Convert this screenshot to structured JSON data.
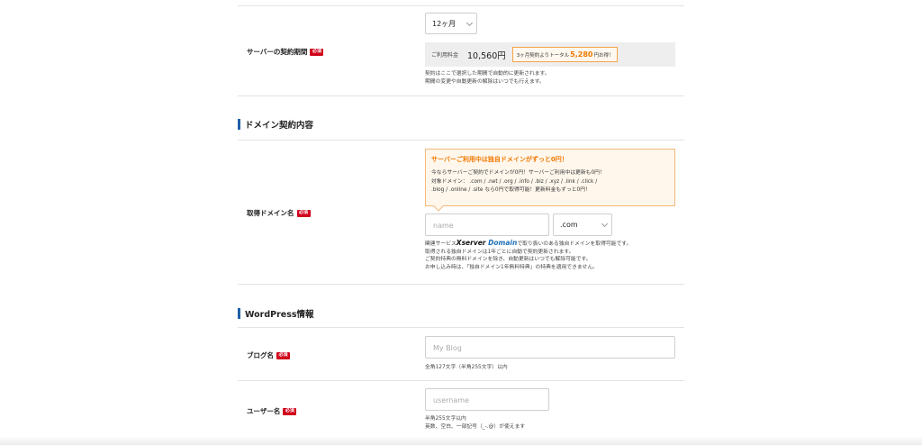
{
  "server_period": {
    "label": "サーバーの契約期間",
    "required": "必須",
    "select_value": "12ヶ月",
    "price_label": "ご利用料金",
    "price_value": "10,560円",
    "badge_prefix": "3ヶ月契約よりトータル",
    "badge_amount": "5,280",
    "badge_suffix": "円お得！",
    "notes": [
      "契約はここで選択した期間で自動的に更新されます。",
      "期間の変更や自動更新の解除はいつでも行えます。"
    ]
  },
  "domain_section": {
    "title": "ドメイン契約内容",
    "label": "取得ドメイン名",
    "required": "必須",
    "promo": {
      "title": "サーバーご利用中は独自ドメインがずっと0円！",
      "lines": [
        "今ならサーバーご契約でドメインが0円！サーバーご利用中は更新も0円！",
        "対象ドメイン： .com / .net / .org / .info / .biz / .xyz / .link / .click /",
        ".blog / .online / .site なら0円で取得可能！更新料金もずっと0円！"
      ]
    },
    "name_placeholder": "name",
    "tld_value": ".com",
    "note_prefix": "関連サービス",
    "note_logo_x": "Xserver",
    "note_logo_d": "Domain",
    "note_suffix": "で取り扱いのある独自ドメインを取得可能です。",
    "notes": [
      "取得される独自ドメインは1年ごとに自動で契約更新されます。",
      "ご契約特典の無料ドメインを除き、自動更新はいつでも解除可能です。",
      "お申し込み時は、「独自ドメイン1年無料特典」の特典を適用できません。"
    ]
  },
  "wordpress_section": {
    "title": "WordPress情報",
    "blog_label": "ブログ名",
    "blog_required": "必須",
    "blog_placeholder": "My Blog",
    "blog_note": "全角127文字（半角255文字）以内",
    "user_label": "ユーザー名",
    "user_required": "必須",
    "user_placeholder": "username",
    "user_notes": [
      "半角255文字以内",
      "英数、空白、一部記号（_-.@）が使えます"
    ]
  },
  "colors": {
    "accent_blue": "#1f5fa8",
    "required_red": "#d0021b",
    "promo_orange": "#f07800"
  }
}
